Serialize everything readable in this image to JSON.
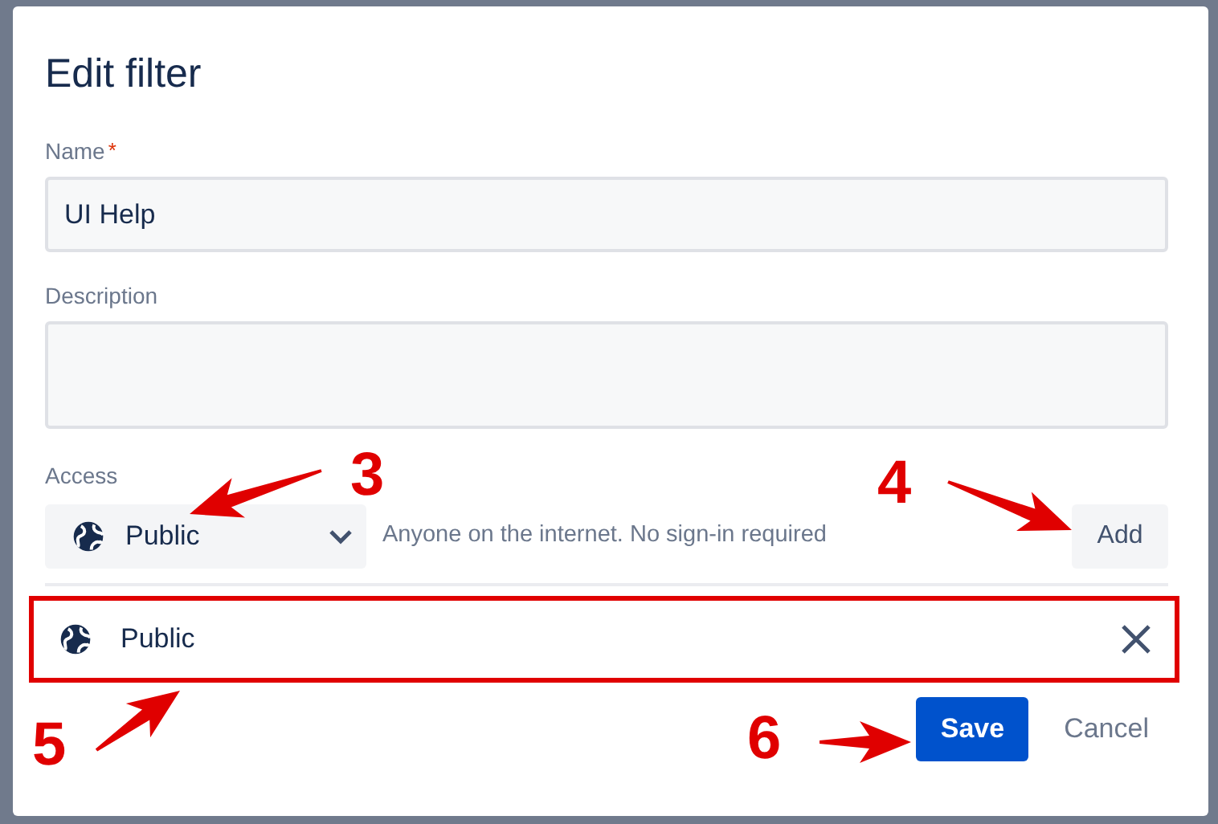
{
  "dialog": {
    "title": "Edit filter",
    "fields": [
      {
        "label": "Name",
        "required_mark": "*",
        "value": "UI Help",
        "kind": "input"
      },
      {
        "label": "Description",
        "kind": "textarea"
      }
    ],
    "access": {
      "label": "Access",
      "select": "Public",
      "hint": "Anyone on the internet. No sign-in required",
      "add_button": "Add",
      "shares": [
        {
          "label": "Public",
          "highlighted": true
        }
      ]
    },
    "buttons": [
      {
        "label": "Save",
        "primary": true
      },
      {
        "label": "Cancel",
        "primary": false
      }
    ]
  },
  "annotations": [
    {
      "label": "3"
    },
    {
      "label": "4"
    },
    {
      "label": "5"
    },
    {
      "label": "6"
    }
  ]
}
